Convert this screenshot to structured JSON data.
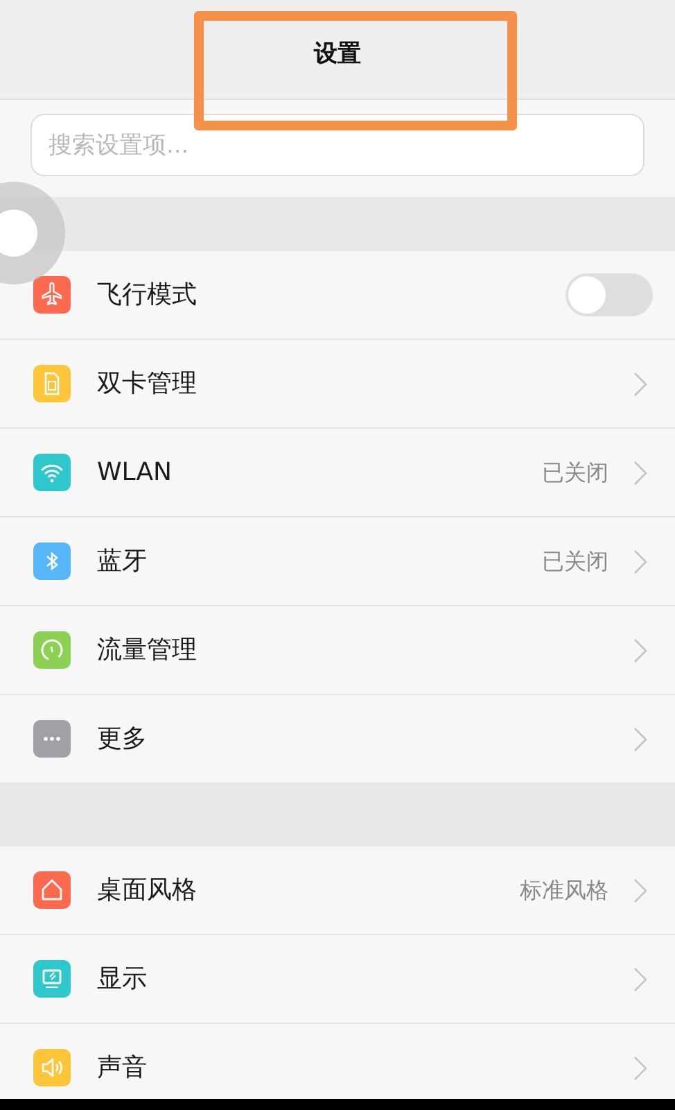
{
  "title": "设置",
  "search": {
    "placeholder": "搜索设置项..."
  },
  "groups": [
    {
      "items": [
        {
          "kind": "toggle",
          "color": "#fb6a4e",
          "label": "飞行模式",
          "on": false
        },
        {
          "kind": "nav",
          "color": "#fdc63a",
          "label": "双卡管理"
        },
        {
          "kind": "nav",
          "color": "#2ec7cc",
          "label": "WLAN",
          "value": "已关闭"
        },
        {
          "kind": "nav",
          "color": "#56b6f7",
          "label": "蓝牙",
          "value": "已关闭"
        },
        {
          "kind": "nav",
          "color": "#8bd154",
          "label": "流量管理"
        },
        {
          "kind": "nav",
          "color": "#a0a0a6",
          "label": "更多"
        }
      ]
    },
    {
      "items": [
        {
          "kind": "nav",
          "color": "#fb6a4e",
          "label": "桌面风格",
          "value": "标准风格"
        },
        {
          "kind": "nav",
          "color": "#2ec7cc",
          "label": "显示"
        },
        {
          "kind": "nav",
          "color": "#fdc63a",
          "label": "声音"
        }
      ]
    }
  ]
}
